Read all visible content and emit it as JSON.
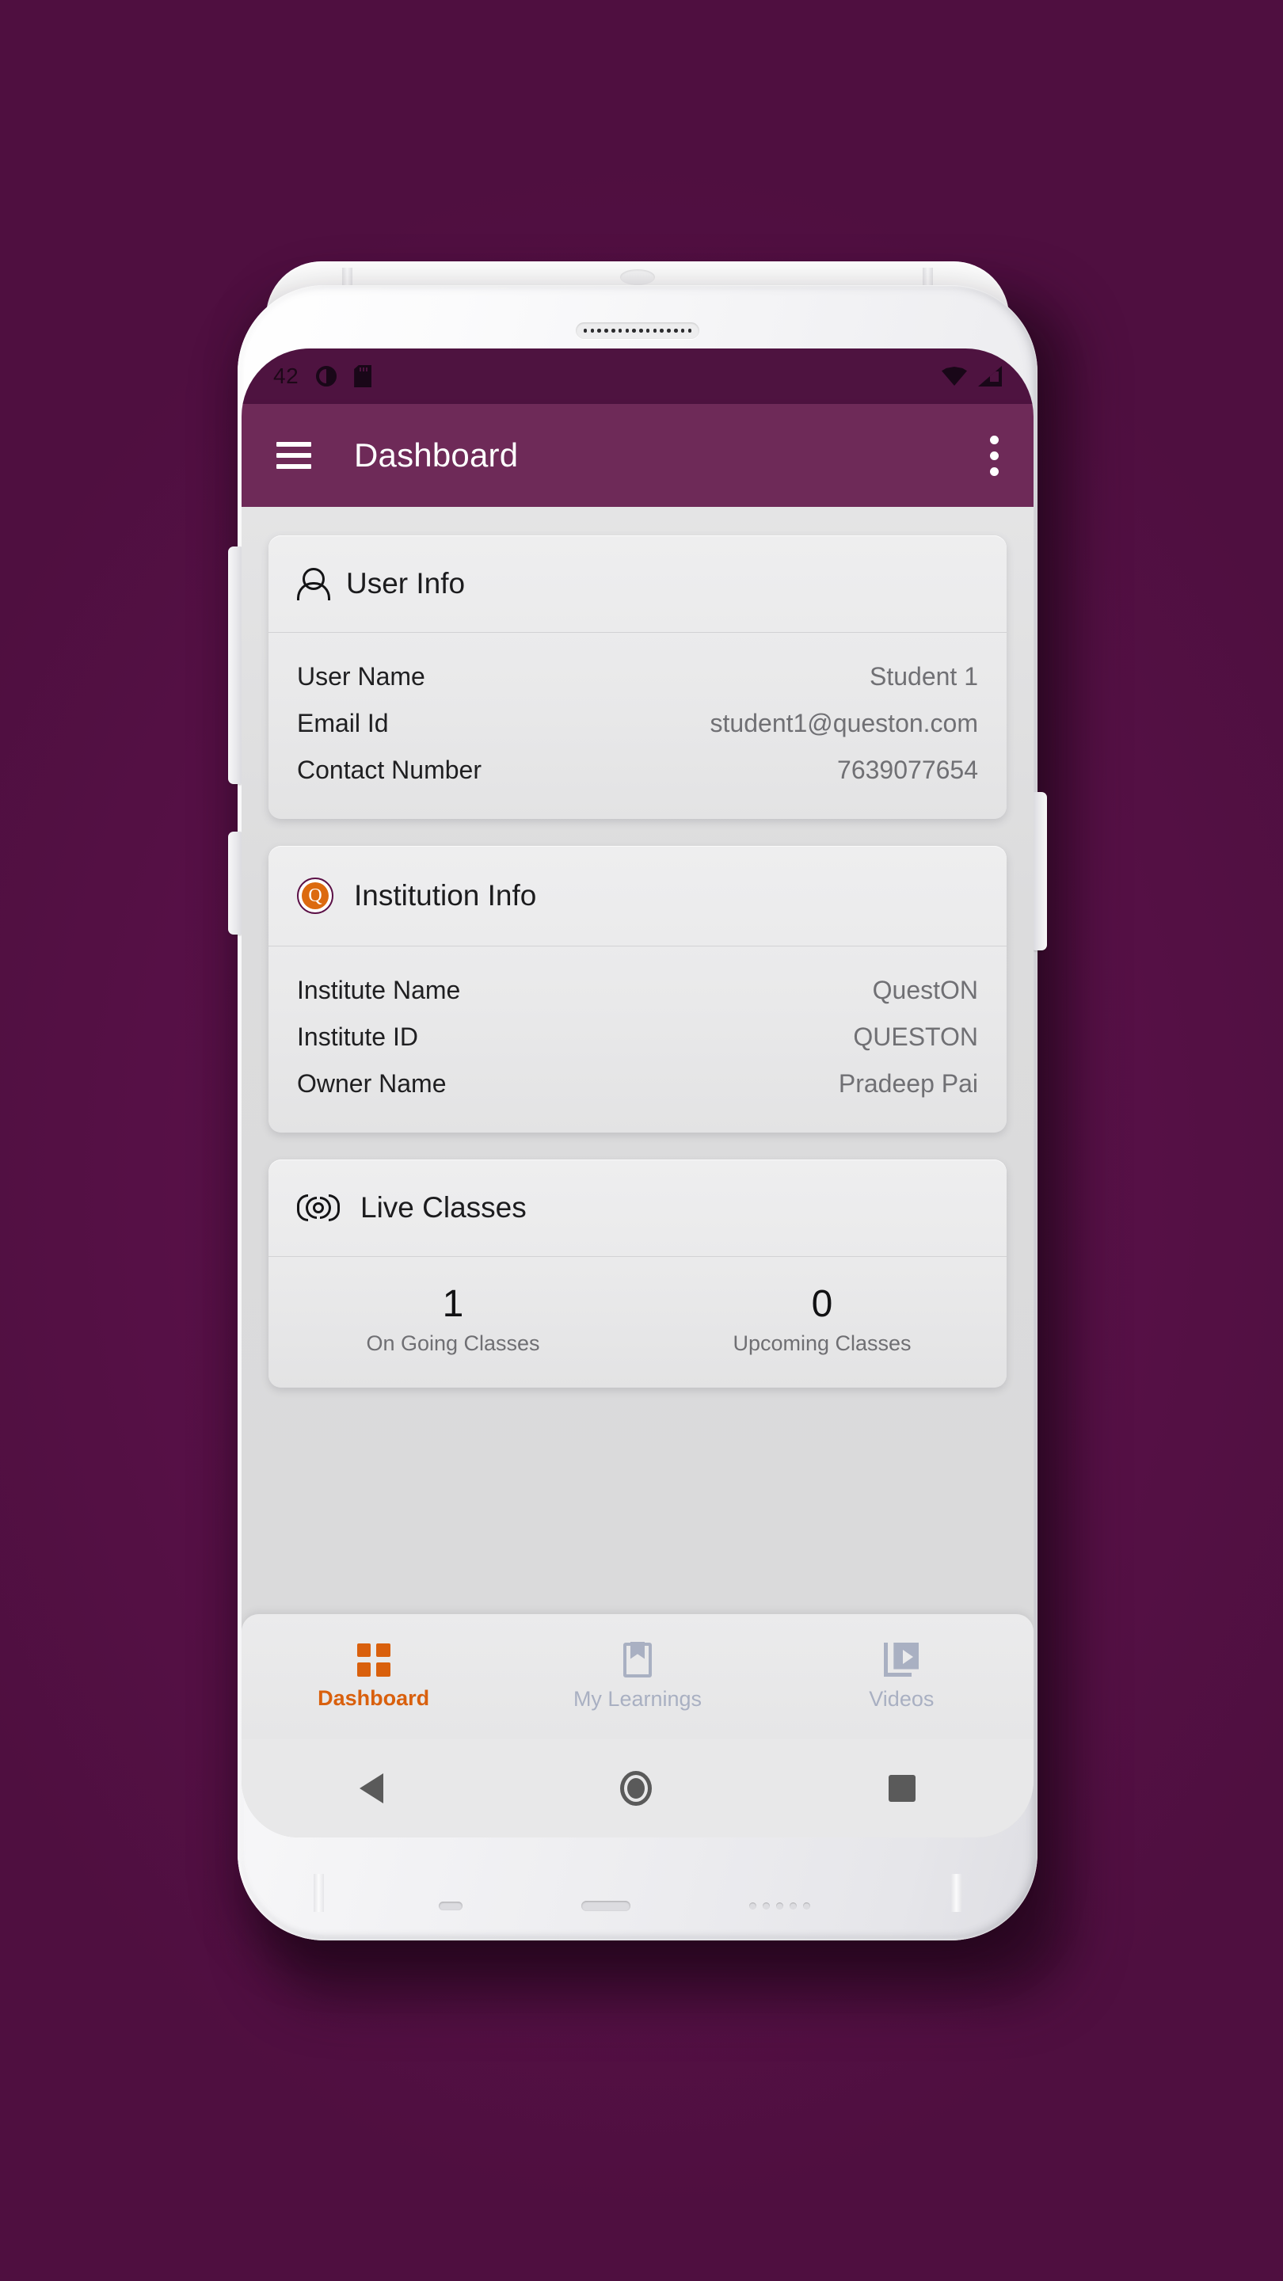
{
  "theme": {
    "backdrop_color": "#57114A",
    "appbar_color": "#6E2A58",
    "statusbar_color": "#4E1340",
    "accent_color": "#D9600D",
    "inactive_nav_color": "#A9B0C2",
    "screen_bg_color": "#DEDEDE",
    "card_bg_color": "#E9E9EA"
  },
  "statusbar": {
    "time": "42",
    "left_icons": [
      "dnd-icon",
      "sd-card-icon"
    ],
    "right_icons": [
      "wifi-icon",
      "signal-icon"
    ]
  },
  "appbar": {
    "menu_icon": "hamburger-menu-icon",
    "title": "Dashboard",
    "overflow_icon": "overflow-menu-icon"
  },
  "cards": [
    {
      "id": "user-info",
      "icon": "person-icon",
      "title": "User Info",
      "rows": [
        {
          "label": "User Name",
          "value": "Student 1"
        },
        {
          "label": "Email Id",
          "value": "student1@queston.com"
        },
        {
          "label": "Contact Number",
          "value": "7639077654"
        }
      ]
    },
    {
      "id": "institution-info",
      "icon": "queston-logo-icon",
      "icon_letter": "Q",
      "title": "Institution Info",
      "rows": [
        {
          "label": "Institute Name",
          "value": "QuestON"
        },
        {
          "label": "Institute ID",
          "value": "QUESTON"
        },
        {
          "label": "Owner Name",
          "value": "Pradeep Pai"
        }
      ]
    },
    {
      "id": "live-classes",
      "icon": "broadcast-icon",
      "title": "Live Classes",
      "stats": [
        {
          "number": "1",
          "label": "On Going Classes"
        },
        {
          "number": "0",
          "label": "Upcoming Classes"
        }
      ]
    }
  ],
  "bottom_nav": {
    "items": [
      {
        "id": "dashboard",
        "icon": "grid-icon",
        "label": "Dashboard",
        "active": true
      },
      {
        "id": "my-learnings",
        "icon": "book-icon",
        "label": "My Learnings",
        "active": false
      },
      {
        "id": "videos",
        "icon": "video-icon",
        "label": "Videos",
        "active": false
      }
    ]
  },
  "android_nav": {
    "back": "back-triangle-icon",
    "home": "home-circle-icon",
    "recents": "recents-square-icon"
  }
}
